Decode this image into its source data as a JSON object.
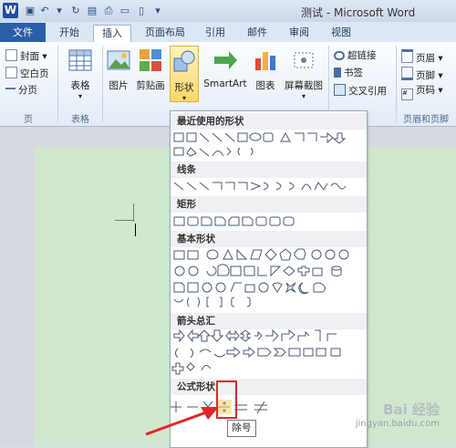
{
  "window": {
    "title": "测试 - Microsoft Word",
    "app_icon": "W"
  },
  "quick_access": [
    "save-icon",
    "undo-icon",
    "redo-icon",
    "print-preview-icon",
    "open-icon",
    "new-icon",
    "customize-icon"
  ],
  "tabs": [
    "文件",
    "开始",
    "插入",
    "页面布局",
    "引用",
    "邮件",
    "审阅",
    "视图"
  ],
  "active_tab": "插入",
  "ribbon": {
    "pages_group": {
      "label": "页",
      "items": [
        "封面",
        "空白页",
        "分页"
      ]
    },
    "table_group": {
      "label": "表格",
      "button": "表格"
    },
    "illustrations": {
      "picture": "图片",
      "clipart": "剪贴画",
      "shapes": "形状",
      "smartart": "SmartArt",
      "chart": "图表",
      "screenshot": "屏幕截图"
    },
    "links_group": {
      "items": [
        "超链接",
        "书签",
        "交叉引用"
      ]
    },
    "header_group": {
      "label": "页眉和页脚",
      "items": [
        "页眉",
        "页脚",
        "页码"
      ]
    }
  },
  "gallery": {
    "sections": [
      "最近使用的形状",
      "线条",
      "矩形",
      "基本形状",
      "箭头总汇",
      "公式形状"
    ],
    "tooltip": "除号"
  },
  "watermark": {
    "line1": "Bai 经验",
    "line2": "jingyan.baidu.com"
  },
  "colors": {
    "accent": "#2a5ea8",
    "highlight": "#e1262a",
    "page": "#cfe8cf"
  }
}
